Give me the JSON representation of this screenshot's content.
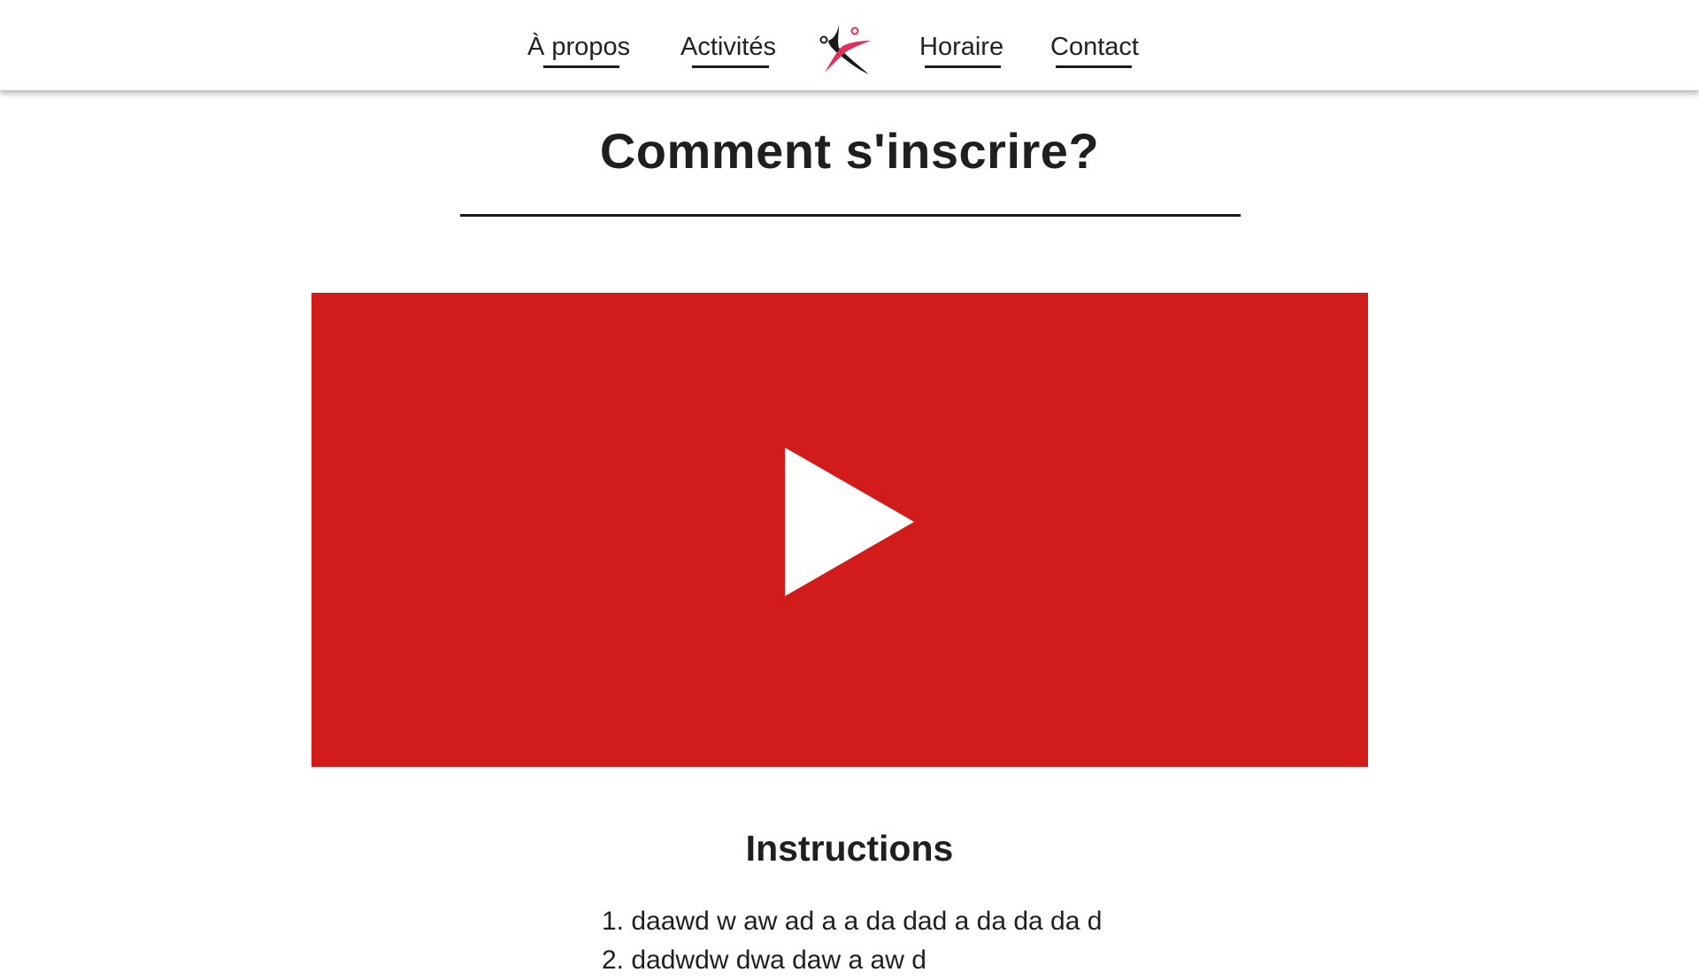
{
  "nav": {
    "items": [
      {
        "label": "À propos"
      },
      {
        "label": "Activités"
      },
      {
        "label": "Horaire"
      },
      {
        "label": "Contact"
      }
    ],
    "logo_icon": "dancer-logo-icon"
  },
  "main": {
    "title": "Comment s'inscrire?",
    "video": {
      "background_color": "#d21c1c",
      "play_icon": "play-icon"
    },
    "instructions": {
      "heading": "Instructions",
      "steps": [
        "1. daawd w aw ad a a da dad a da da da d",
        "2. dadwdw dwa daw a aw d"
      ]
    }
  },
  "colors": {
    "accent_red": "#d21c1c",
    "logo_pink": "#e0305a",
    "text": "#1f1f1f"
  }
}
